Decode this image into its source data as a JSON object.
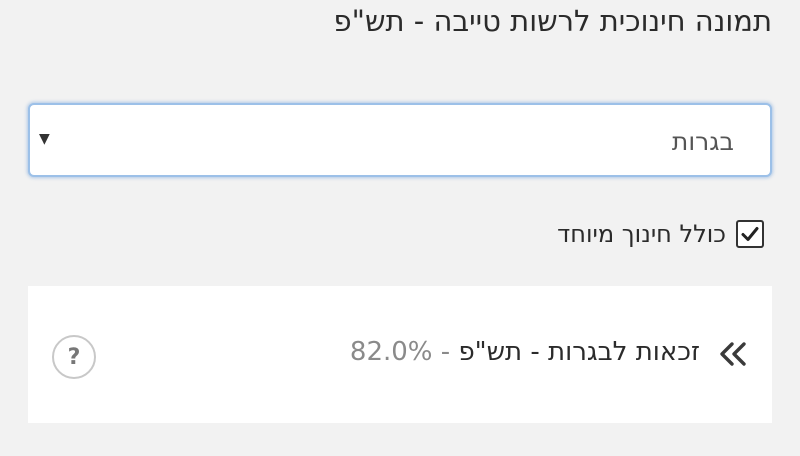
{
  "header": {
    "title": "תמונה חינוכית לרשות טייבה - תש\"פ"
  },
  "filter": {
    "selected": "בגרות",
    "arrow_icon": "dropdown-arrow-icon"
  },
  "special_ed": {
    "label": "כולל חינוך מיוחד",
    "checked": true
  },
  "metric_card": {
    "title": "זכאות לבגרות - תש\"פ",
    "separator": "-",
    "value": "82.0%",
    "help_symbol": "?",
    "expand_icon": "double-chevron-left-icon"
  },
  "colors": {
    "background": "#f2f2f2",
    "focus_border": "#9cc0e8",
    "card_background": "#ffffff",
    "muted_text": "#8a8a8a"
  }
}
